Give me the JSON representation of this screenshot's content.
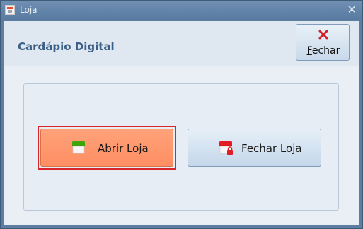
{
  "window": {
    "title": "Loja",
    "close_glyph": "✕"
  },
  "header": {
    "title": "Cardápio Digital",
    "close_button": {
      "label": "Fechar",
      "icon": "red-x-icon"
    }
  },
  "actions": {
    "open_store": {
      "label": "Abrir Loja",
      "icon": "store-open-icon",
      "accent": "#ff9468",
      "focused": true
    },
    "close_store": {
      "label": "Fechar Loja",
      "icon": "store-closed-icon"
    }
  },
  "colors": {
    "title_text": "#3b5f86",
    "focus_border": "#d8262b",
    "open_icon_green": "#3fa60a",
    "closed_icon_red": "#e31b23"
  }
}
